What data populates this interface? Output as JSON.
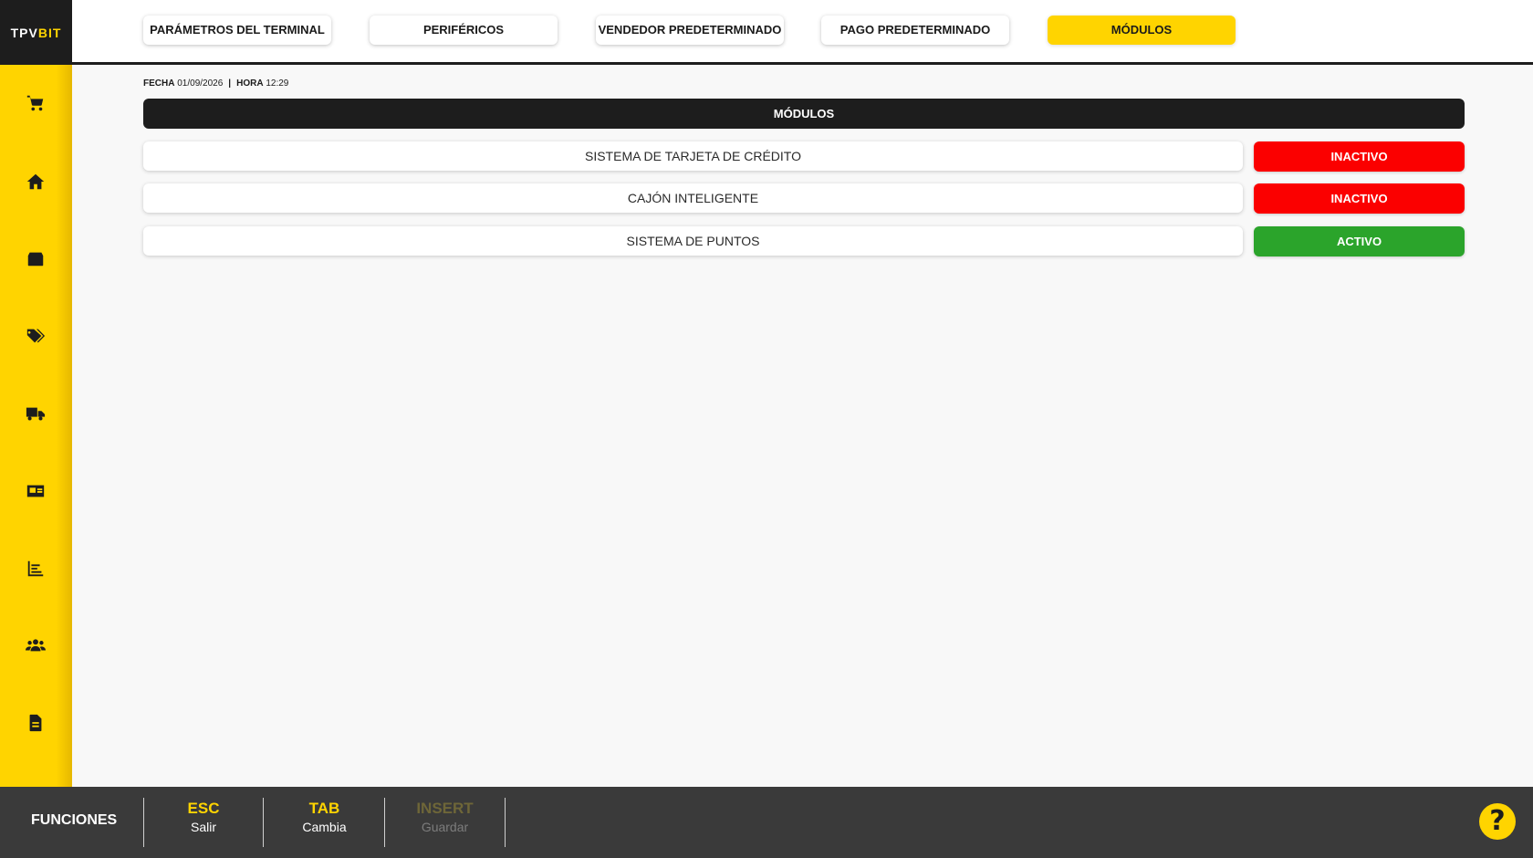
{
  "brand": {
    "logo_main": "TPV",
    "logo_accent": "BIT"
  },
  "tabs": [
    {
      "label": "PARÁMETROS DEL TERMINAL",
      "active": false
    },
    {
      "label": "PERIFÉRICOS",
      "active": false
    },
    {
      "label": "VENDEDOR PREDETERMINADO",
      "active": false
    },
    {
      "label": "PAGO PREDETERMINADO",
      "active": false
    },
    {
      "label": "MÓDULOS",
      "active": true
    }
  ],
  "sidebar": {
    "items": [
      {
        "icon": "cart-icon"
      },
      {
        "icon": "home-icon"
      },
      {
        "icon": "box-icon"
      },
      {
        "icon": "tags-icon"
      },
      {
        "icon": "truck-icon"
      },
      {
        "icon": "id-card-icon"
      },
      {
        "icon": "chart-icon"
      },
      {
        "icon": "users-icon"
      },
      {
        "icon": "document-icon"
      }
    ]
  },
  "datetime": {
    "date_label": "FECHA",
    "date_value": "01/09/2026",
    "separator": "|",
    "time_label": "HORA",
    "time_value": "12:29"
  },
  "section": {
    "title": "MÓDULOS"
  },
  "modules": [
    {
      "name": "SISTEMA DE TARJETA DE CRÉDITO",
      "status": "INACTIVO",
      "active": false
    },
    {
      "name": "CAJÓN INTELIGENTE",
      "status": "INACTIVO",
      "active": false
    },
    {
      "name": "SISTEMA DE PUNTOS",
      "status": "ACTIVO",
      "active": true
    }
  ],
  "footer": {
    "title": "FUNCIONES",
    "keys": [
      {
        "key": "ESC",
        "desc": "Salir",
        "enabled": true
      },
      {
        "key": "TAB",
        "desc": "Cambia",
        "enabled": true
      },
      {
        "key": "INSERT",
        "desc": "Guardar",
        "enabled": false
      }
    ],
    "help": "?"
  },
  "colors": {
    "accent": "#ffd400",
    "dark": "#1d1d1d",
    "inactive": "#fb0000",
    "active": "#2ba42b",
    "footer_bg": "#3a3a3a"
  }
}
